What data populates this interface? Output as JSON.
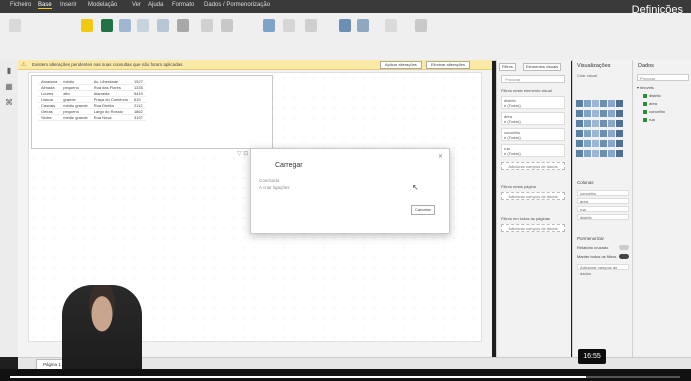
{
  "window": {
    "title": "Definições"
  },
  "menu_tabs": [
    "Ficheiro",
    "Base",
    "Inserir",
    "Modelação",
    "Ver",
    "Ajuda",
    "Formato",
    "Dados / Pormenorização"
  ],
  "warning": {
    "text": "Existem alterações pendentes nas suas consultas que não foram aplicadas.",
    "apply_label": "Aplicar alterações",
    "dismiss_label": "Eliminar alterações"
  },
  "table_rows": [
    [
      "Amadora",
      "médio",
      "Av. Liberdade",
      "1927"
    ],
    [
      "Almada",
      "pequeno",
      "Rua das Flores",
      "1335"
    ],
    [
      "Loures",
      "alto",
      "Alameda",
      "5419"
    ],
    [
      "Lisboa",
      "grande",
      "Praça do Comércio",
      "615"
    ],
    [
      "Cascais",
      "médio grande",
      "Rua Direita",
      "2112"
    ],
    [
      "Oeiras",
      "pequeno",
      "Largo do Rossio",
      "1862"
    ],
    [
      "Sintra",
      "médio grande",
      "Rua Nova",
      "3197"
    ]
  ],
  "dialog": {
    "title": "Carregar",
    "line1": "Concluído",
    "line2": "A criar ligações",
    "cancel_label": "Cancelar"
  },
  "filters": {
    "tab_filters": "Filtros",
    "tab_visuals": "Elementos visuais",
    "search_placeholder": "Procurar",
    "section_visual": "Filtros neste elemento visual",
    "cards": [
      {
        "title": "distrito",
        "value": "é (Todos)"
      },
      {
        "title": "área",
        "value": "é (Todos)"
      },
      {
        "title": "concelho",
        "value": "é (Todos)"
      },
      {
        "title": "rua",
        "value": "é (Todos)"
      }
    ],
    "add_label": "Adicionar campos de dados",
    "section_page": "Filtros nesta página",
    "section_all": "Filtros em todas as páginas"
  },
  "visualizations": {
    "title": "Visualizações",
    "subtitle": "Criar visual",
    "columns_label": "Colunas",
    "fields": [
      "concelho",
      "área",
      "rua",
      "distrito"
    ],
    "drill_label": "Pormenorizar",
    "cross_report": "Relatório cruzado",
    "keep_filters": "Manter todos os filtros",
    "add_drill": "Adicionar campos de dados"
  },
  "data_pane": {
    "title": "Dados",
    "search_placeholder": "Procurar",
    "table_name": "imoveis",
    "fields": [
      "distrito",
      "área",
      "concelho",
      "rua"
    ]
  },
  "page": {
    "tab_label": "Página 1"
  },
  "video": {
    "timestamp": "16:55",
    "progress": 0.86
  }
}
